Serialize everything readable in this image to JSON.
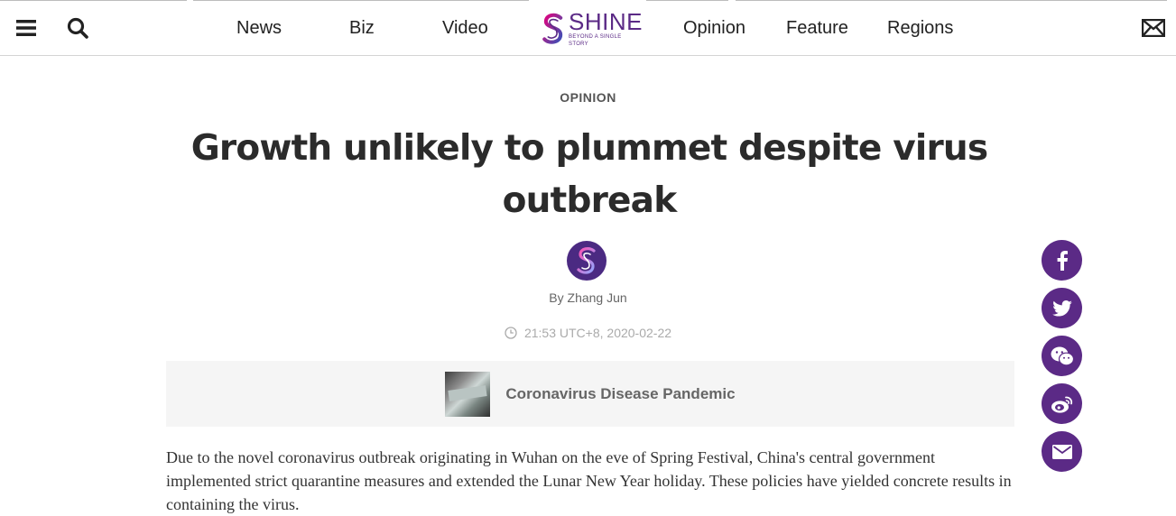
{
  "header": {
    "nav": [
      "News",
      "Biz",
      "Video",
      "Opinion",
      "Feature",
      "Regions"
    ],
    "logo": {
      "name": "SHINE",
      "tagline": "BEYOND A SINGLE STORY"
    },
    "icons": {
      "menu": "menu-icon",
      "search": "search-icon",
      "mail": "mail-icon"
    }
  },
  "article": {
    "category": "OPINION",
    "title": "Growth unlikely to plummet despite virus outbreak",
    "byline": "By Zhang Jun",
    "timestamp": "21:53 UTC+8, 2020-02-22",
    "topic": "Coronavirus Disease Pandemic",
    "body": "Due to the novel coronavirus outbreak originating in Wuhan on the eve of Spring Festival, China's central government implemented strict quarantine measures and extended the Lunar New Year holiday. These policies have yielded concrete results in containing the virus."
  },
  "share": [
    "facebook-icon",
    "twitter-icon",
    "wechat-icon",
    "weibo-icon",
    "email-icon"
  ],
  "colors": {
    "brand": "#5b2a86",
    "topic_bg": "#f5f5f5",
    "divider": "#d4d4d4"
  }
}
